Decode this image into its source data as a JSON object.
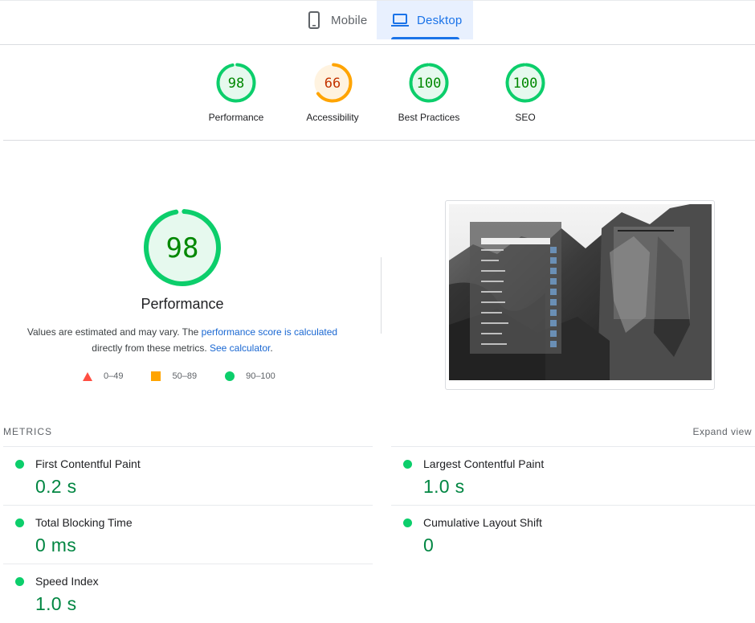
{
  "tabs": [
    {
      "label": "Mobile",
      "active": false
    },
    {
      "label": "Desktop",
      "active": true
    }
  ],
  "scores": [
    {
      "label": "Performance",
      "score": 98,
      "status": "good"
    },
    {
      "label": "Accessibility",
      "score": 66,
      "status": "average"
    },
    {
      "label": "Best Practices",
      "score": 100,
      "status": "good"
    },
    {
      "label": "SEO",
      "score": 100,
      "status": "good"
    }
  ],
  "performance": {
    "score": "98",
    "title": "Performance",
    "desc_prefix": "Values are estimated and may vary. The ",
    "desc_link1": "performance score is calculated",
    "desc_middle": " directly from these metrics. ",
    "desc_link2": "See calculator",
    "desc_suffix": "."
  },
  "legend": [
    {
      "range": "0–49",
      "shape": "triangle",
      "color": "#ff4e42"
    },
    {
      "range": "50–89",
      "shape": "square",
      "color": "#ffa400"
    },
    {
      "range": "90–100",
      "shape": "circle",
      "color": "#0cce6b"
    }
  ],
  "metrics": {
    "heading": "METRICS",
    "expand_label": "Expand view",
    "items": [
      {
        "title": "First Contentful Paint",
        "value": "0.2 s"
      },
      {
        "title": "Largest Contentful Paint",
        "value": "1.0 s"
      },
      {
        "title": "Total Blocking Time",
        "value": "0 ms"
      },
      {
        "title": "Cumulative Layout Shift",
        "value": "0"
      },
      {
        "title": "Speed Index",
        "value": "1.0 s"
      }
    ]
  },
  "colors": {
    "good": "#0cce6b",
    "good_text": "#008800",
    "good_fill": "#e6f9ee",
    "average": "#ffa400",
    "average_text": "#c33300",
    "average_fill": "#fff3e0",
    "accent": "#1a73e8"
  }
}
